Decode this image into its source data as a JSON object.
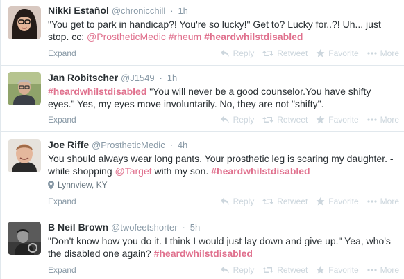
{
  "actions": {
    "expand": "Expand",
    "reply": "Reply",
    "retweet": "Retweet",
    "favorite": "Favorite",
    "more": "More"
  },
  "tweets": [
    {
      "name": "Nikki Estañol",
      "handle": "@chronicchill",
      "separator": "·",
      "time": "1h",
      "segments": [
        {
          "text": "\"You get to park in handicap?! You're so lucky!\" Get to? Lucky for..?! Uh... just stop. cc: ",
          "type": "plain"
        },
        {
          "text": "@ProstheticMedic",
          "type": "mention"
        },
        {
          "text": " ",
          "type": "plain"
        },
        {
          "text": "#rheum",
          "type": "mention"
        },
        {
          "text": " ",
          "type": "plain"
        },
        {
          "text": "#heardwhilstdisabled",
          "type": "tag"
        }
      ],
      "location": ""
    },
    {
      "name": "Jan Robitscher",
      "handle": "@J1549",
      "separator": "·",
      "time": "1h",
      "segments": [
        {
          "text": "#heardwhilstdisabled",
          "type": "tag"
        },
        {
          "text": " \"You will never be a good counselor.You have shifty eyes.\" Yes, my eyes move involuntarily. No, they are not \"shifty\".",
          "type": "plain"
        }
      ],
      "location": ""
    },
    {
      "name": "Joe Riffe",
      "handle": "@ProstheticMedic",
      "separator": "·",
      "time": "4h",
      "segments": [
        {
          "text": "You should always wear long pants. Your prosthetic leg is scaring my daughter. - while shopping ",
          "type": "plain"
        },
        {
          "text": "@Target",
          "type": "mention"
        },
        {
          "text": " with my son. ",
          "type": "plain"
        },
        {
          "text": "#heardwhilstdisabled",
          "type": "tag"
        }
      ],
      "location": "Lynnview, KY"
    },
    {
      "name": "B Neil Brown",
      "handle": "@twofeetshorter",
      "separator": "·",
      "time": "5h",
      "segments": [
        {
          "text": "\"Don't know how you do it. I think I would just lay down and give up.\" Yea, who's the disabled one again? ",
          "type": "plain"
        },
        {
          "text": "#heardwhilstdisabled",
          "type": "tag"
        }
      ],
      "location": ""
    }
  ]
}
